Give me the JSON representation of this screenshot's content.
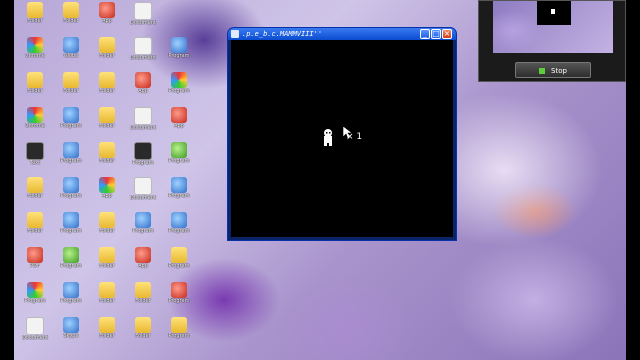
{
  "desktop": {
    "icons": [
      {
        "label": "Folder",
        "glyph": "folder-icon",
        "col": 0,
        "row": 0
      },
      {
        "label": "Folder",
        "glyph": "folder-icon",
        "col": 1,
        "row": 0
      },
      {
        "label": "App",
        "glyph": "red-icon",
        "col": 2,
        "row": 0
      },
      {
        "label": "Document",
        "glyph": "doc-icon",
        "col": 3,
        "row": 0
      },
      {
        "label": "Chrome",
        "glyph": "multi-icon",
        "col": 0,
        "row": 1
      },
      {
        "label": "Globe",
        "glyph": "blue-icon",
        "col": 1,
        "row": 1
      },
      {
        "label": "Folder",
        "glyph": "folder-icon",
        "col": 2,
        "row": 1
      },
      {
        "label": "Document",
        "glyph": "doc-icon",
        "col": 3,
        "row": 1
      },
      {
        "label": "Program",
        "glyph": "blue-icon",
        "col": 4,
        "row": 1
      },
      {
        "label": "Folder",
        "glyph": "folder-icon",
        "col": 0,
        "row": 2
      },
      {
        "label": "Folder",
        "glyph": "folder-icon",
        "col": 1,
        "row": 2
      },
      {
        "label": "Folder",
        "glyph": "folder-icon",
        "col": 2,
        "row": 2
      },
      {
        "label": "App",
        "glyph": "red-icon",
        "col": 3,
        "row": 2
      },
      {
        "label": "Program",
        "glyph": "multi-icon",
        "col": 4,
        "row": 2
      },
      {
        "label": "Chrome",
        "glyph": "multi-icon",
        "col": 0,
        "row": 3
      },
      {
        "label": "Program",
        "glyph": "blue-icon",
        "col": 1,
        "row": 3
      },
      {
        "label": "Folder",
        "glyph": "folder-icon",
        "col": 2,
        "row": 3
      },
      {
        "label": "Document",
        "glyph": "doc-icon",
        "col": 3,
        "row": 3
      },
      {
        "label": "App",
        "glyph": "red-icon",
        "col": 4,
        "row": 3
      },
      {
        "label": "Text",
        "glyph": "dark-icon",
        "col": 0,
        "row": 4
      },
      {
        "label": "Program",
        "glyph": "blue-icon",
        "col": 1,
        "row": 4
      },
      {
        "label": "Folder",
        "glyph": "folder-icon",
        "col": 2,
        "row": 4
      },
      {
        "label": "Program",
        "glyph": "dark-icon",
        "col": 3,
        "row": 4
      },
      {
        "label": "Program",
        "glyph": "green-icon",
        "col": 4,
        "row": 4
      },
      {
        "label": "Folder",
        "glyph": "folder-icon",
        "col": 0,
        "row": 5
      },
      {
        "label": "Program",
        "glyph": "blue-icon",
        "col": 1,
        "row": 5
      },
      {
        "label": "App",
        "glyph": "multi-icon",
        "col": 2,
        "row": 5
      },
      {
        "label": "Document",
        "glyph": "doc-icon",
        "col": 3,
        "row": 5
      },
      {
        "label": "Program",
        "glyph": "blue-icon",
        "col": 4,
        "row": 5
      },
      {
        "label": "Folder",
        "glyph": "folder-icon",
        "col": 0,
        "row": 6
      },
      {
        "label": "Program",
        "glyph": "blue-icon",
        "col": 1,
        "row": 6
      },
      {
        "label": "Folder",
        "glyph": "folder-icon",
        "col": 2,
        "row": 6
      },
      {
        "label": "Program",
        "glyph": "blue-icon",
        "col": 3,
        "row": 6
      },
      {
        "label": "Program",
        "glyph": "blue-icon",
        "col": 4,
        "row": 6
      },
      {
        "label": "PDF",
        "glyph": "red-icon",
        "col": 0,
        "row": 7
      },
      {
        "label": "Program",
        "glyph": "green-icon",
        "col": 1,
        "row": 7
      },
      {
        "label": "Folder",
        "glyph": "folder-icon",
        "col": 2,
        "row": 7
      },
      {
        "label": "App",
        "glyph": "red-icon",
        "col": 3,
        "row": 7
      },
      {
        "label": "Program",
        "glyph": "folder-icon",
        "col": 4,
        "row": 7
      },
      {
        "label": "Program",
        "glyph": "multi-icon",
        "col": 0,
        "row": 8
      },
      {
        "label": "Program",
        "glyph": "blue-icon",
        "col": 1,
        "row": 8
      },
      {
        "label": "Folder",
        "glyph": "folder-icon",
        "col": 2,
        "row": 8
      },
      {
        "label": "Folder",
        "glyph": "folder-icon",
        "col": 3,
        "row": 8
      },
      {
        "label": "Program",
        "glyph": "red-icon",
        "col": 4,
        "row": 8
      },
      {
        "label": "Document",
        "glyph": "doc-icon",
        "col": 0,
        "row": 9
      },
      {
        "label": "Skype",
        "glyph": "blue-icon",
        "col": 1,
        "row": 9
      },
      {
        "label": "Folder",
        "glyph": "folder-icon",
        "col": 2,
        "row": 9
      },
      {
        "label": "Folder",
        "glyph": "folder-icon",
        "col": 3,
        "row": 9
      },
      {
        "label": "Program",
        "glyph": "folder-icon",
        "col": 4,
        "row": 9
      }
    ]
  },
  "game_window": {
    "title": ".p.e_b.c.MAMMVIII''",
    "minimize_icon": "minimize-icon",
    "maximize_icon": "maximize-icon",
    "close_icon": "close-icon",
    "lives_text": "× 1"
  },
  "recorder": {
    "stop_label": "Stop",
    "stop_color": "#5ccd3a"
  },
  "colors": {
    "titlebar": "#0a4bd0",
    "game_bg": "#000000"
  }
}
